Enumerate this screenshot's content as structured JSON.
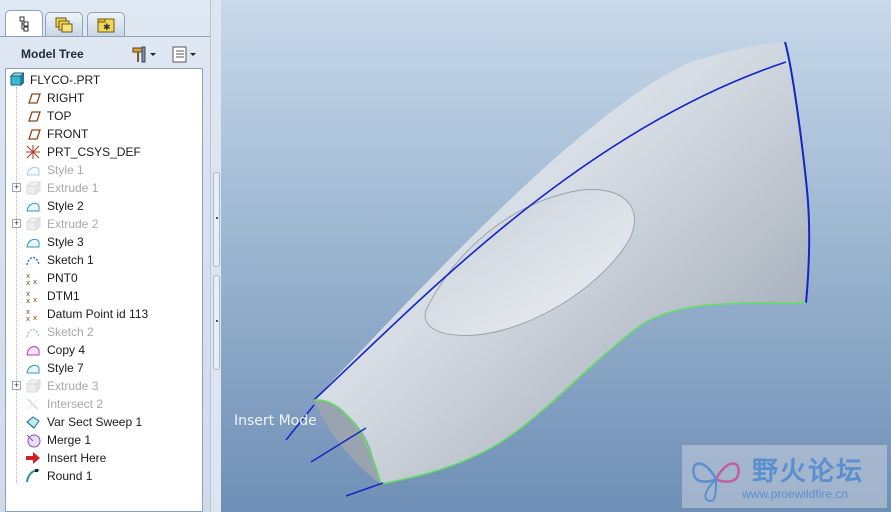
{
  "tabs": [
    {
      "name": "model-tree-tab-icon",
      "active": true
    },
    {
      "name": "layers-tab-icon",
      "active": false
    },
    {
      "name": "favorites-tab-icon",
      "active": false
    }
  ],
  "header": {
    "title": "Model Tree"
  },
  "tree": {
    "items": [
      {
        "label": "FLYCO-.PRT",
        "icon": "part-icon",
        "suppressed": false,
        "expandable": false
      },
      {
        "label": "RIGHT",
        "icon": "datum-plane-icon",
        "suppressed": false,
        "expandable": false
      },
      {
        "label": "TOP",
        "icon": "datum-plane-icon",
        "suppressed": false,
        "expandable": false
      },
      {
        "label": "FRONT",
        "icon": "datum-plane-icon",
        "suppressed": false,
        "expandable": false
      },
      {
        "label": "PRT_CSYS_DEF",
        "icon": "csys-icon",
        "suppressed": false,
        "expandable": false
      },
      {
        "label": "Style 1",
        "icon": "style-icon",
        "suppressed": true,
        "expandable": false
      },
      {
        "label": "Extrude 1",
        "icon": "extrude-icon",
        "suppressed": true,
        "expandable": true
      },
      {
        "label": "Style 2",
        "icon": "style-icon",
        "suppressed": false,
        "expandable": false
      },
      {
        "label": "Extrude 2",
        "icon": "extrude-icon",
        "suppressed": true,
        "expandable": true
      },
      {
        "label": "Style 3",
        "icon": "style-icon",
        "suppressed": false,
        "expandable": false
      },
      {
        "label": "Sketch 1",
        "icon": "sketch-icon",
        "suppressed": false,
        "expandable": false
      },
      {
        "label": "PNT0",
        "icon": "datum-point-icon",
        "suppressed": false,
        "expandable": false
      },
      {
        "label": "DTM1",
        "icon": "datum-point-icon",
        "suppressed": false,
        "expandable": false
      },
      {
        "label": "Datum Point id 113",
        "icon": "datum-point-icon",
        "suppressed": false,
        "expandable": false
      },
      {
        "label": "Sketch 2",
        "icon": "sketch-icon",
        "suppressed": true,
        "expandable": false
      },
      {
        "label": "Copy 4",
        "icon": "copy-icon",
        "suppressed": false,
        "expandable": false
      },
      {
        "label": "Style 7",
        "icon": "style-icon",
        "suppressed": false,
        "expandable": false
      },
      {
        "label": "Extrude 3",
        "icon": "extrude-icon",
        "suppressed": true,
        "expandable": true
      },
      {
        "label": "Intersect 2",
        "icon": "intersect-icon",
        "suppressed": true,
        "expandable": false
      },
      {
        "label": "Var Sect Sweep 1",
        "icon": "sweep-icon",
        "suppressed": false,
        "expandable": false
      },
      {
        "label": "Merge 1",
        "icon": "merge-icon",
        "suppressed": false,
        "expandable": false
      },
      {
        "label": "Insert Here",
        "icon": "insert-arrow-icon",
        "suppressed": false,
        "expandable": false
      },
      {
        "label": "Round 1",
        "icon": "round-icon",
        "suppressed": false,
        "expandable": false
      }
    ]
  },
  "viewport": {
    "mode_label": "Insert Mode"
  },
  "watermark": {
    "title": "野火论坛",
    "url": "www.proewildfire.cn"
  },
  "colors": {
    "curve_blue": "#1326c8",
    "edge_green": "#5fe05f",
    "watermark_blue": "#5a8fd0"
  }
}
